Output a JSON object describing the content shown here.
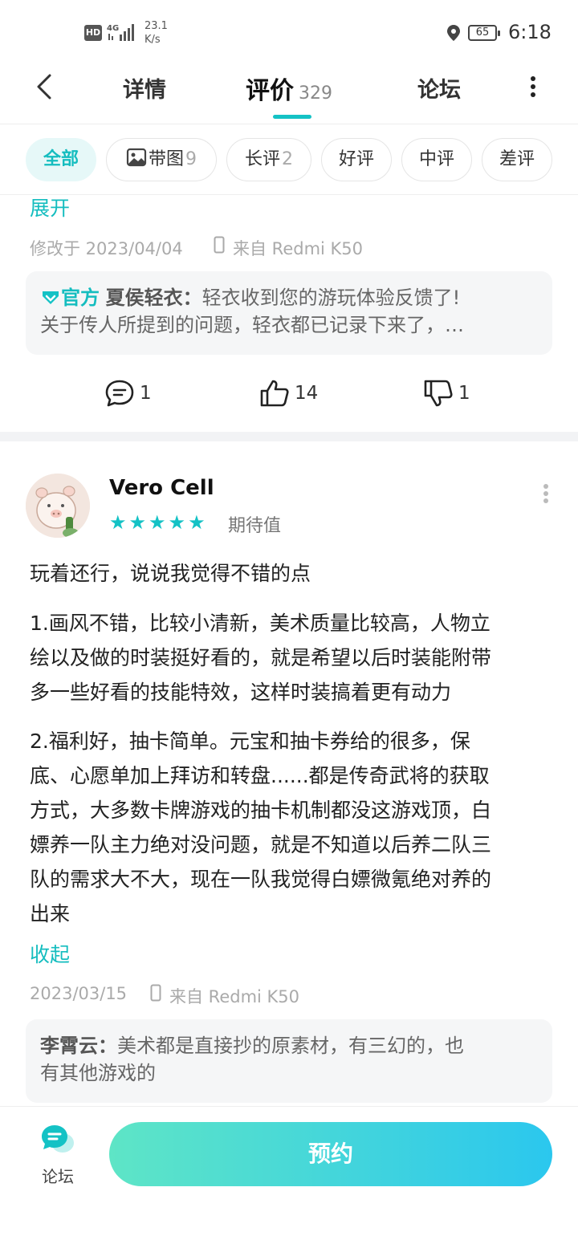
{
  "status_bar": {
    "hd": "HD",
    "network": "4G",
    "speed_value": "23.1",
    "speed_unit": "K/s",
    "battery": "65",
    "time": "6:18"
  },
  "header": {
    "tabs": [
      {
        "label": "详情"
      },
      {
        "label": "评价",
        "count": "329"
      },
      {
        "label": "论坛"
      }
    ]
  },
  "filters": [
    {
      "label": "全部"
    },
    {
      "label": "带图",
      "count": "9"
    },
    {
      "label": "长评",
      "count": "2"
    },
    {
      "label": "好评"
    },
    {
      "label": "中评"
    },
    {
      "label": "差评"
    }
  ],
  "review1": {
    "expand": "展开",
    "modified": "修改于 2023/04/04",
    "device": "来自 Redmi K50",
    "reply": {
      "badge": "官方",
      "author": "夏侯轻衣",
      "sep": "：",
      "line1": "轻衣收到您的游玩体验反馈了!",
      "line2": "关于传人所提到的问题，轻衣都已记录下来了，…"
    },
    "comments": "1",
    "likes": "14",
    "dislikes": "1"
  },
  "review2": {
    "username": "Vero Cell",
    "rating": 5,
    "tag": "期待值",
    "paragraphs": [
      [
        "玩着还行，说说我觉得不错的点"
      ],
      [
        "1.画风不错，比较小清新，美术质量比较高，人物立",
        "绘以及做的时装挺好看的，就是希望以后时装能附带",
        "多一些好看的技能特效，这样时装搞着更有动力"
      ],
      [
        "2.福利好，抽卡简单。元宝和抽卡券给的很多，保",
        "底、心愿单加上拜访和转盘......都是传奇武将的获取",
        "方式，大多数卡牌游戏的抽卡机制都没这游戏顶，白",
        "嫖养一队主力绝对没问题，就是不知道以后养二队三",
        "队的需求大不大，现在一队我觉得白嫖微氪绝对养的",
        "出来"
      ]
    ],
    "collapse": "收起",
    "date": "2023/03/15",
    "device": "来自 Redmi K50",
    "reply": {
      "author": "李霄云",
      "sep": "：",
      "line1": "美术都是直接抄的原素材，有三幻的，也",
      "line2": "有其他游戏的"
    }
  },
  "bottom": {
    "forum_label": "论坛",
    "reserve_label": "预约"
  },
  "colors": {
    "accent": "#14c2c5",
    "gradient_start": "#5ee5c6",
    "gradient_end": "#2bc7ee"
  }
}
